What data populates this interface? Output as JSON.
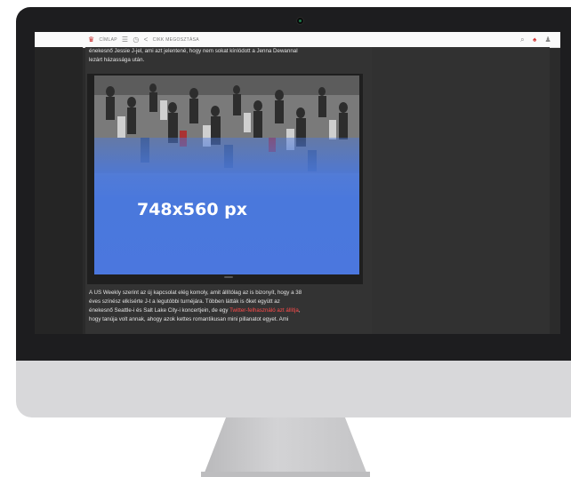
{
  "topbar": {
    "home_label": "CÍMLAP",
    "share_label": "CIKK MEGOSZTÁSA",
    "icons": [
      "brand-icon",
      "menu-icon",
      "clock-icon",
      "share-icon",
      "search-icon",
      "notification-icon",
      "user-icon"
    ]
  },
  "article": {
    "para1_line1": "énekesnő Jessie J-jel, ami azt jelentené, hogy nem sokat kínlódott a Jenna Dewannal",
    "para1_line2": "lezárt házassága után.",
    "image_placeholder": "748x560 px",
    "para2_line1": "A US Weekly szerint az új kapcsolat elég komoly, amit állítólag az is bizonyít, hogy a 38",
    "para2_line2": "éves színész elkísérte J-t a legutóbbi turnéjára. Többen látták is őket együtt az",
    "para2_line3_pre": "énekesnő Seattle-i és Salt Lake City-i koncertjein, de egy ",
    "para2_line3_link": "Twitter-felhasználó azt állítja",
    "para2_line3_post": ",",
    "para2_line4": "hogy tanúja volt annak, ahogy azok kettes romantikusan mini pillanatot egyet. Ami"
  },
  "colors": {
    "bezel": "#1d1d1f",
    "chin": "#d8d8da",
    "screen_bg": "#2b2b2b",
    "link": "#ff4b4b",
    "placeholder_blue": "#4a78dc"
  }
}
